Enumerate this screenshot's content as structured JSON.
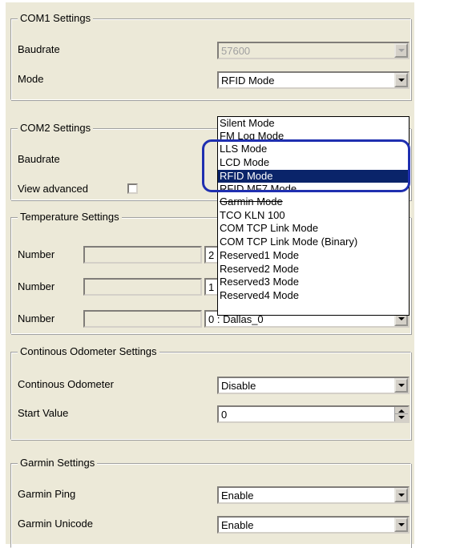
{
  "com1": {
    "title": "COM1 Settings",
    "baudrate_label": "Baudrate",
    "baudrate_value": "57600",
    "mode_label": "Mode",
    "mode_value": "RFID Mode"
  },
  "com2": {
    "title": "COM2 Settings",
    "baudrate_label": "Baudrate",
    "view_advanced_label": "View advanced"
  },
  "temperature": {
    "title": "Temperature Settings",
    "rows": [
      {
        "label": "Number",
        "sensor_value": "2"
      },
      {
        "label": "Number",
        "sensor_value": "1"
      },
      {
        "label": "Number",
        "sensor_value": "0 : Dallas_0"
      }
    ]
  },
  "odometer": {
    "title": "Continous Odometer Settings",
    "continuous_label": "Continous Odometer",
    "continuous_value": "Disable",
    "start_label": "Start Value",
    "start_value": "0"
  },
  "garmin": {
    "title": "Garmin Settings",
    "ping_label": "Garmin Ping",
    "ping_value": "Enable",
    "unicode_label": "Garmin Unicode",
    "unicode_value": "Enable"
  },
  "mode_dropdown": {
    "selected": "RFID Mode",
    "options": [
      "Silent Mode",
      "FM Log Mode",
      "LLS Mode",
      "LCD Mode",
      "RFID Mode",
      "RFID MF7 Mode",
      "Garmin Mode",
      "TCO KLN 100",
      "COM TCP Link Mode",
      "COM TCP Link Mode (Binary)",
      "Reserved1 Mode",
      "Reserved2 Mode",
      "Reserved3 Mode",
      "Reserved4 Mode"
    ]
  },
  "colors": {
    "selection": "#0a246a",
    "annotation_outline": "#1f2fb0",
    "dialog_background": "#ece9d8"
  }
}
